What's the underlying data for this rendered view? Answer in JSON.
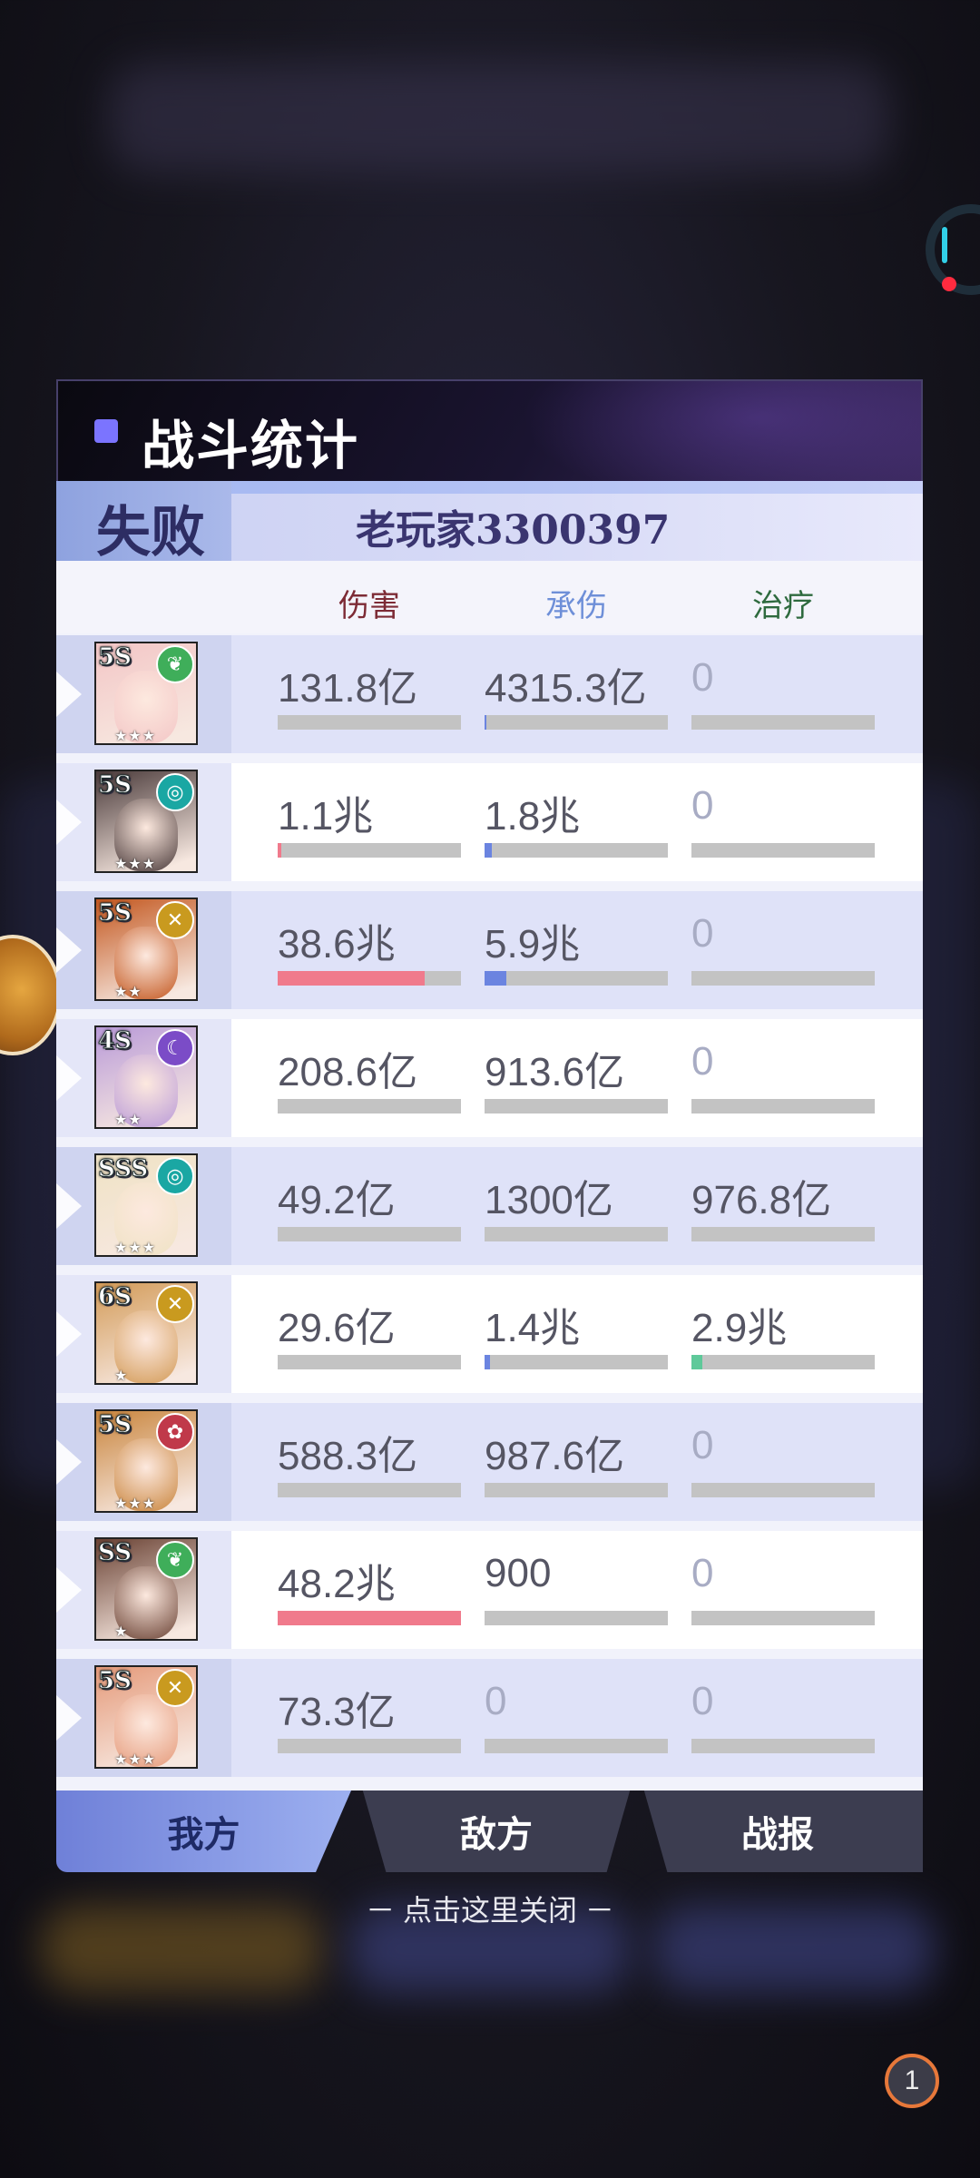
{
  "header": {
    "title": "战斗统计"
  },
  "result": {
    "status": "失败",
    "player_name": "老玩家3300397"
  },
  "columns": {
    "damage": "伤害",
    "taken": "承伤",
    "heal": "治疗"
  },
  "colors": {
    "damage_bar": "#f07a8c",
    "taken_bar": "#6b84e0",
    "heal_bar": "#5fc99a",
    "accent": "#7b74ff"
  },
  "rows": [
    {
      "grade": "5S",
      "element_icon": "leaf-icon",
      "element_color": "#3fae5a",
      "stars": "★★★",
      "portrait_color": "#f3c6c6",
      "damage": "131.8亿",
      "taken": "4315.3亿",
      "heal": "0",
      "damage_fill": 0.0,
      "taken_fill": 0.01,
      "heal_fill": 0
    },
    {
      "grade": "5S",
      "element_icon": "swirl-icon",
      "element_color": "#1aa7a3",
      "stars": "★★★",
      "portrait_color": "#4a3a3a",
      "damage": "1.1兆",
      "taken": "1.8兆",
      "heal": "0",
      "damage_fill": 0.02,
      "taken_fill": 0.04,
      "heal_fill": 0
    },
    {
      "grade": "5S",
      "element_icon": "cross-icon",
      "element_color": "#c99a1f",
      "stars": "★★",
      "portrait_color": "#c3571f",
      "damage": "38.6兆",
      "taken": "5.9兆",
      "heal": "0",
      "damage_fill": 0.8,
      "taken_fill": 0.12,
      "heal_fill": 0
    },
    {
      "grade": "4S",
      "element_icon": "moon-icon",
      "element_color": "#7b4cc7",
      "stars": "★★",
      "portrait_color": "#b99ad8",
      "damage": "208.6亿",
      "taken": "913.6亿",
      "heal": "0",
      "damage_fill": 0,
      "taken_fill": 0,
      "heal_fill": 0
    },
    {
      "grade": "SSS",
      "element_icon": "swirl-icon",
      "element_color": "#1aa7a3",
      "stars": "★★★",
      "portrait_color": "#efe2c4",
      "damage": "49.2亿",
      "taken": "1300亿",
      "heal": "976.8亿",
      "damage_fill": 0,
      "taken_fill": 0,
      "heal_fill": 0
    },
    {
      "grade": "6S",
      "element_icon": "cross-icon",
      "element_color": "#c99a1f",
      "stars": "★",
      "portrait_color": "#d39b58",
      "damage": "29.6亿",
      "taken": "1.4兆",
      "heal": "2.9兆",
      "damage_fill": 0,
      "taken_fill": 0.03,
      "heal_fill": 0.06
    },
    {
      "grade": "5S",
      "element_icon": "rose-icon",
      "element_color": "#c0394a",
      "stars": "★★★",
      "portrait_color": "#c9853d",
      "damage": "588.3亿",
      "taken": "987.6亿",
      "heal": "0",
      "damage_fill": 0,
      "taken_fill": 0,
      "heal_fill": 0
    },
    {
      "grade": "SS",
      "element_icon": "leaf-icon",
      "element_color": "#3fae5a",
      "stars": "★",
      "portrait_color": "#6a4234",
      "damage": "48.2兆",
      "taken": "900",
      "heal": "0",
      "damage_fill": 1.0,
      "taken_fill": 0,
      "heal_fill": 0
    },
    {
      "grade": "5S",
      "element_icon": "cross-icon",
      "element_color": "#c99a1f",
      "stars": "★★★",
      "portrait_color": "#e59a7a",
      "damage": "73.3亿",
      "taken": "0",
      "heal": "0",
      "damage_fill": 0,
      "taken_fill": 0,
      "heal_fill": 0
    }
  ],
  "tabs": {
    "mine": "我方",
    "enemy": "敌方",
    "report": "战报"
  },
  "close_hint": "－ 点击这里关闭 －",
  "page_badge": "1"
}
